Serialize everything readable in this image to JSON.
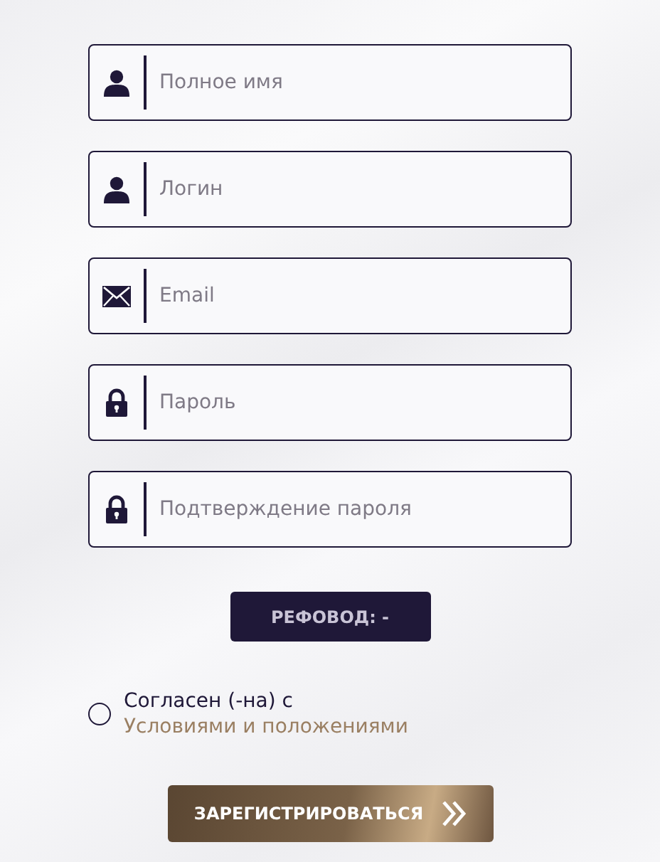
{
  "fields": [
    {
      "kind": "user",
      "placeholder": "Полное имя"
    },
    {
      "kind": "user",
      "placeholder": "Логин"
    },
    {
      "kind": "mail",
      "placeholder": "Email"
    },
    {
      "kind": "lock",
      "placeholder": "Пароль"
    },
    {
      "kind": "lock",
      "placeholder": "Подтверждение пароля"
    }
  ],
  "referrer_button": "РЕФОВОД: -",
  "consent": {
    "checked": false,
    "text": "Согласен (-на) с",
    "link": "Условиями и положениями"
  },
  "register_button": "ЗАРЕГИСТРИРОВАТЬСЯ"
}
